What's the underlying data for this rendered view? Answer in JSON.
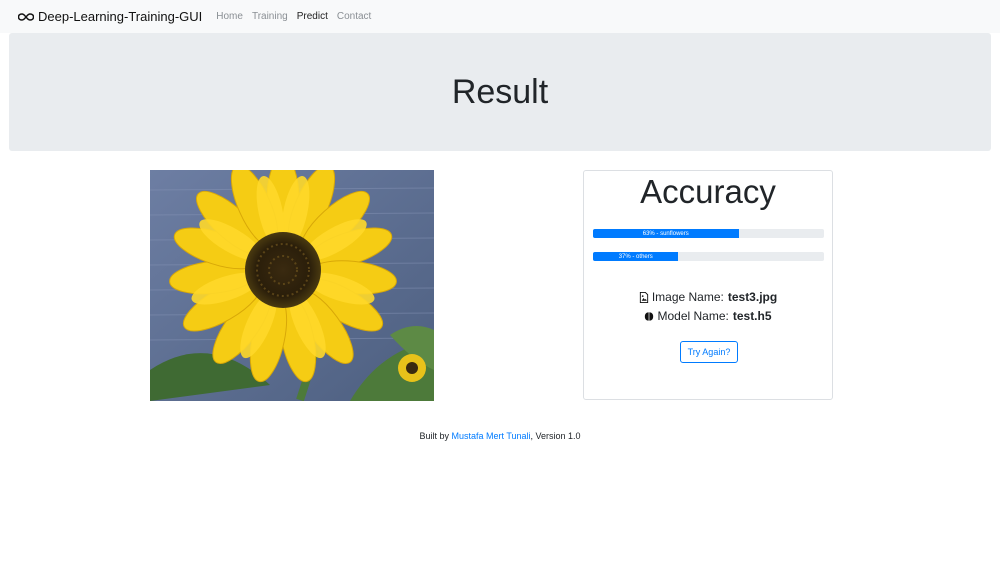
{
  "navbar": {
    "brand": "Deep-Learning-Training-GUI",
    "brand_icon": "infinity-icon",
    "links": [
      {
        "label": "Home",
        "active": false
      },
      {
        "label": "Training",
        "active": false
      },
      {
        "label": "Predict",
        "active": true
      },
      {
        "label": "Contact",
        "active": false
      }
    ]
  },
  "header": {
    "title": "Result"
  },
  "image": {
    "subject": "sunflower-photo"
  },
  "result_card": {
    "title": "Accuracy",
    "predictions": [
      {
        "label": "63% - sunflowers",
        "percent": 63
      },
      {
        "label": "37% - others",
        "percent": 37
      }
    ],
    "image_name_label": "Image Name:",
    "image_name_value": "test3.jpg",
    "image_icon": "file-image-icon",
    "model_name_label": "Model Name:",
    "model_name_value": "test.h5",
    "model_icon": "brain-icon",
    "try_again_label": "Try Again?"
  },
  "footer": {
    "prefix": "Built by",
    "author": "Mustafa Mert Tunali",
    "suffix": ", Version 1.0"
  },
  "colors": {
    "primary": "#007bff",
    "jumbotron": "#e9ecef",
    "navbar": "#f8f9fa"
  }
}
